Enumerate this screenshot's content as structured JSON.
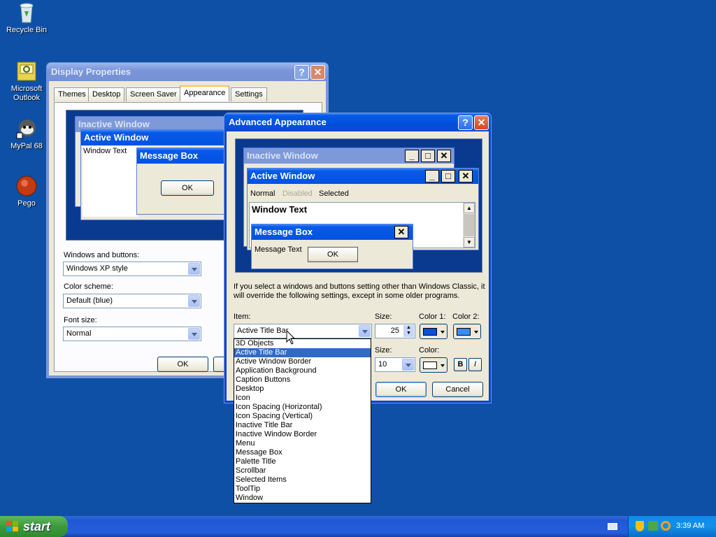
{
  "desktop": {
    "icons": [
      {
        "label": "Recycle Bin",
        "icon": "recycle-bin-icon"
      },
      {
        "label": "Microsoft Outlook",
        "icon": "outlook-icon"
      },
      {
        "label": "MyPal 68",
        "icon": "mypal-icon"
      },
      {
        "label": "Pego",
        "icon": "pego-icon"
      }
    ]
  },
  "display_properties": {
    "title": "Display Properties",
    "tabs": [
      "Themes",
      "Desktop",
      "Screen Saver",
      "Appearance",
      "Settings"
    ],
    "active_tab": "Appearance",
    "preview": {
      "inactive_title": "Inactive Window",
      "active_title": "Active Window",
      "window_text": "Window Text",
      "message_box_title": "Message Box",
      "ok": "OK"
    },
    "windows_buttons_label": "Windows and buttons:",
    "windows_buttons_value": "Windows XP style",
    "color_scheme_label": "Color scheme:",
    "color_scheme_value": "Default (blue)",
    "font_size_label": "Font size:",
    "font_size_value": "Normal",
    "ok": "OK"
  },
  "advanced": {
    "title": "Advanced Appearance",
    "preview": {
      "inactive_title": "Inactive Window",
      "active_title": "Active Window",
      "menu_normal": "Normal",
      "menu_disabled": "Disabled",
      "menu_selected": "Selected",
      "window_text": "Window Text",
      "message_box_title": "Message Box",
      "message_text": "Message Text",
      "ok": "OK"
    },
    "info": "If you select a windows and buttons setting other than Windows Classic, it will override the following settings, except in some older programs.",
    "item_label": "Item:",
    "item_value": "Active Title Bar",
    "size_label": "Size:",
    "size_value": "25",
    "color1_label": "Color 1:",
    "color2_label": "Color 2:",
    "font_size_label": "Size:",
    "font_size_value": "10",
    "font_color_label": "Color:",
    "bold": "B",
    "italic": "I",
    "ok": "OK",
    "cancel": "Cancel",
    "colors": {
      "color1": "#0a50d8",
      "color2": "#3c8cf8",
      "font_color": "#ffffff"
    }
  },
  "item_dropdown": {
    "options": [
      "3D Objects",
      "Active Title Bar",
      "Active Window Border",
      "Application Background",
      "Caption Buttons",
      "Desktop",
      "Icon",
      "Icon Spacing (Horizontal)",
      "Icon Spacing (Vertical)",
      "Inactive Title Bar",
      "Inactive Window Border",
      "Menu",
      "Message Box",
      "Palette Title",
      "Scrollbar",
      "Selected Items",
      "ToolTip",
      "Window"
    ],
    "selected": "Active Title Bar"
  },
  "taskbar": {
    "start_label": "start",
    "clock": "3:39 AM"
  }
}
